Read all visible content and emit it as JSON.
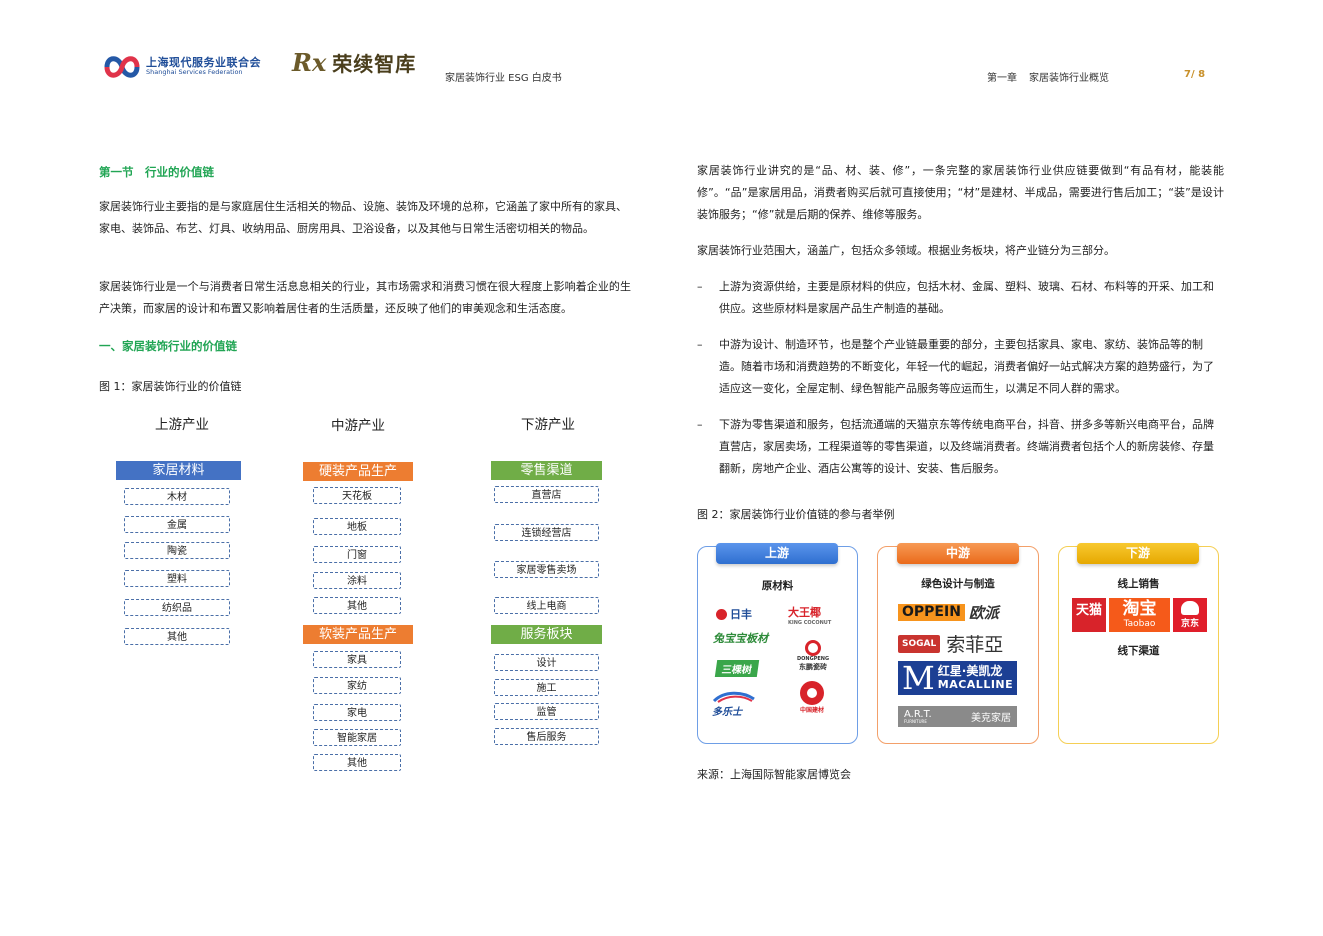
{
  "header": {
    "sf_logo_cn": "上海现代服务业联合会",
    "sf_logo_en": "Shanghai Services Federation",
    "rx_logo_mark": "Rx",
    "rx_logo_name": "荣续智库",
    "doc_title": "家居装饰行业 ESG 白皮书",
    "chapter": "第一章",
    "chapter_title": "家居装饰行业概览",
    "page": "7/ 8"
  },
  "left": {
    "section_title": "第一节　行业的价值链",
    "para1": "家居装饰行业主要指的是与家庭居住生活相关的物品、设施、装饰及环境的总称，它涵盖了家中所有的家具、家电、装饰品、布艺、灯具、收纳用品、厨房用具、卫浴设备，以及其他与日常生活密切相关的物品。",
    "para2": "家居装饰行业是一个与消费者日常生活息息相关的行业，其市场需求和消费习惯在很大程度上影响着企业的生产决策，而家居的设计和布置又影响着居住者的生活质量，还反映了他们的审美观念和生活态度。",
    "subsection_title": "一、家居装饰行业的价值链",
    "fig1_caption": "图 1：家居装饰行业的价值链"
  },
  "fig1": {
    "columns": [
      "上游产业",
      "中游产业",
      "下游产业"
    ],
    "upstream_category": "家居材料",
    "upstream_items": [
      "木材",
      "金属",
      "陶瓷",
      "塑料",
      "纺织品",
      "其他"
    ],
    "mid_category1": "硬装产品生产",
    "mid_items1": [
      "天花板",
      "地板",
      "门窗",
      "涂料",
      "其他"
    ],
    "mid_category2": "软装产品生产",
    "mid_items2": [
      "家具",
      "家纺",
      "家电",
      "智能家居",
      "其他"
    ],
    "down_category1": "零售渠道",
    "down_items1": [
      "直营店",
      "连锁经营店",
      "家居零售卖场",
      "线上电商"
    ],
    "down_category2": "服务板块",
    "down_items2": [
      "设计",
      "施工",
      "监管",
      "售后服务"
    ],
    "colors": {
      "blue": "#4472c4",
      "orange": "#ed7d31",
      "green": "#70ad47"
    }
  },
  "right": {
    "para1": "家居装饰行业讲究的是“品、材、装、修”，一条完整的家居装饰行业供应链要做到“有品有材，能装能修”。“品”是家居用品，消费者购买后就可直接使用；“材”是建材、半成品，需要进行售后加工；“装”是设计装饰服务；“修”就是后期的保养、维修等服务。",
    "para2": "家居装饰行业范围大，涵盖广，包括众多领域。根据业务板块，将产业链分为三部分。",
    "bullets": [
      "上游为资源供给，主要是原材料的供应，包括木材、金属、塑料、玻璃、石材、布料等的开采、加工和供应。这些原材料是家居产品生产制造的基础。",
      "中游为设计、制造环节，也是整个产业链最重要的部分，主要包括家具、家电、家纺、装饰品等的制造。随着市场和消费趋势的不断变化，年轻一代的崛起，消费者偏好一站式解决方案的趋势盛行，为了适应这一变化，全屋定制、绿色智能产品服务等应运而生，以满足不同人群的需求。",
      "下游为零售渠道和服务，包括流通端的天猫京东等传统电商平台，抖音、拼多多等新兴电商平台，品牌直营店，家居卖场，工程渠道等的零售渠道，以及终端消费者。终端消费者包括个人的新房装修、存量翻新，房地产企业、酒店公寓等的设计、安装、售后服务。"
    ],
    "bullet_dash": "–",
    "fig2_caption": "图 2：家居装饰行业价值链的参与者举例",
    "source": "来源：上海国际智能家居博览会"
  },
  "fig2": {
    "upstream": {
      "tab": "上游",
      "sub": "原材料",
      "brands": [
        "日丰",
        "大王椰",
        "兔宝宝板材",
        "东鹏瓷砖",
        "三棵树",
        "多乐士",
        "中国建材"
      ],
      "brand_aux": [
        "KING COCONUT",
        "DONGPENG"
      ],
      "color": "#3a7bd5"
    },
    "midstream": {
      "tab": "中游",
      "sub": "绿色设计与制造",
      "brands": [
        "OPPEIN",
        "欧派",
        "SOGAL",
        "索菲亞",
        "红星·美凯龙",
        "MACALLINE",
        "A.R.T.",
        "美克家居"
      ],
      "brand_aux": [
        "FURNITURE"
      ],
      "color": "#f07a2a"
    },
    "downstream": {
      "tab": "下游",
      "sub1": "线上销售",
      "sub2": "线下渠道",
      "brands": [
        "天猫",
        "淘宝",
        "Taobao",
        "京东"
      ],
      "color": "#f0b400"
    }
  }
}
